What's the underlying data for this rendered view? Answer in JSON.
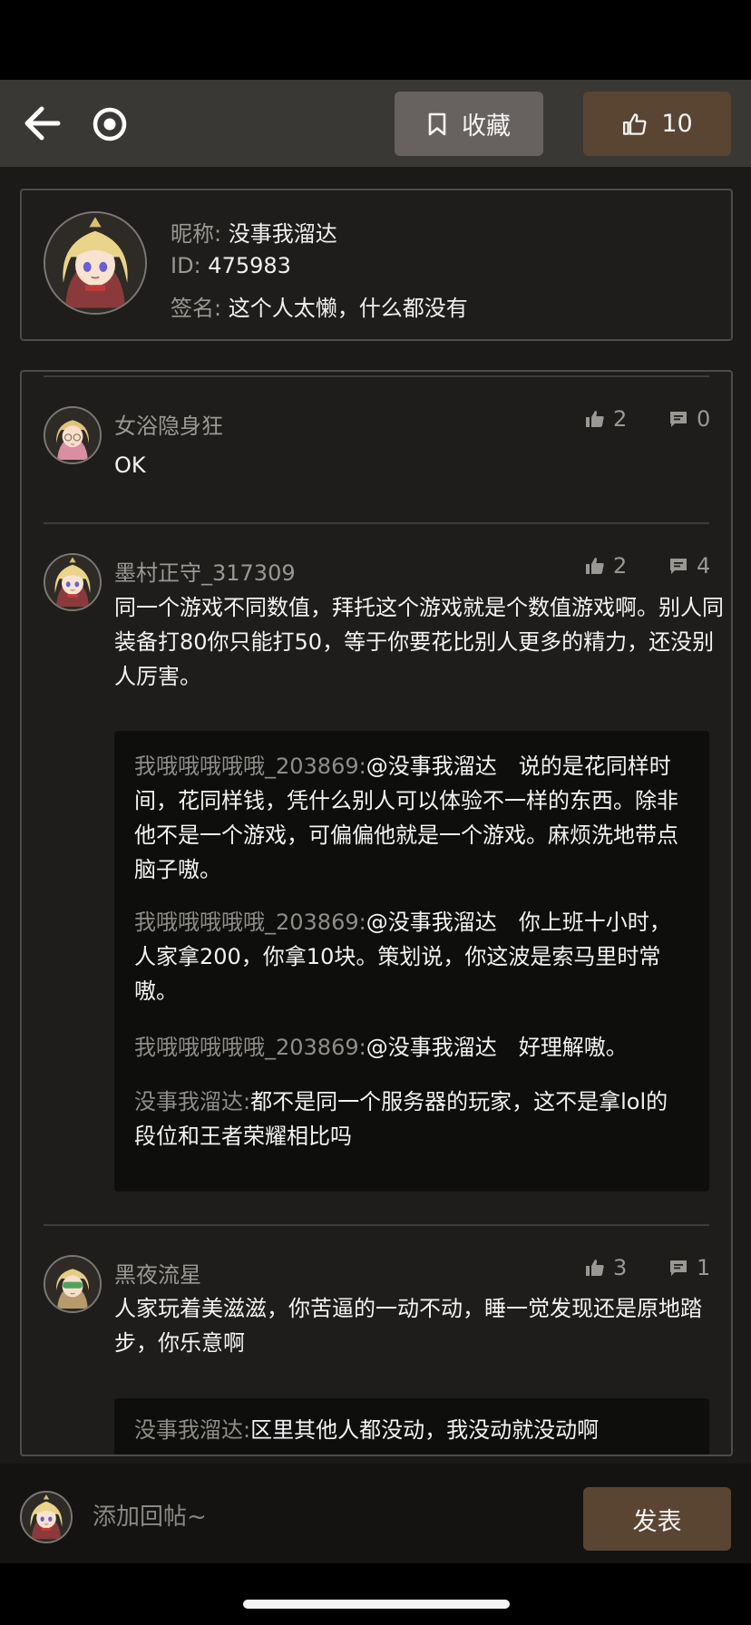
{
  "header": {
    "favorite_label": "收藏",
    "like_count": "10"
  },
  "profile": {
    "nickname_key": "昵称:",
    "nickname": "没事我溜达",
    "id_key": "ID:",
    "id": "475983",
    "signature_key": "签名:",
    "signature": "这个人太懒，什么都没有"
  },
  "comments": [
    {
      "author": "女浴隐身狂",
      "likes": "2",
      "replies_count": "0",
      "text": "OK"
    },
    {
      "author": "墨村正守_317309",
      "likes": "2",
      "replies_count": "4",
      "text": "同一个游戏不同数值，拜托这个游戏就是个数值游戏啊。别人同装备打80你只能打50，等于你要花比别人更多的精力，还没别人厉害。",
      "replies": [
        {
          "name": "我哦哦哦哦哦_203869:",
          "text": "@没事我溜达　说的是花同样时间，花同样钱，凭什么别人可以体验不一样的东西。除非他不是一个游戏，可偏偏他就是一个游戏。麻烦洗地带点脑子嗷。"
        },
        {
          "name": "我哦哦哦哦哦_203869:",
          "text": "@没事我溜达　你上班十小时，人家拿200，你拿10块。策划说，你这波是索马里时常嗷。"
        },
        {
          "name": "我哦哦哦哦哦_203869:",
          "text": "@没事我溜达　好理解嗷。"
        },
        {
          "name": "没事我溜达:",
          "text": "都不是同一个服务器的玩家，这不是拿lol的段位和王者荣耀相比吗"
        }
      ]
    },
    {
      "author": "黑夜流星",
      "likes": "3",
      "replies_count": "1",
      "text": "人家玩着美滋滋，你苦逼的一动不动，睡一觉发现还是原地踏步，你乐意啊",
      "replies": [
        {
          "name": "没事我溜达:",
          "text": "区里其他人都没动，我没动就没动啊"
        }
      ]
    }
  ],
  "composer": {
    "placeholder": "添加回帖~",
    "send_label": "发表"
  },
  "icons": {
    "back": "arrow-left-icon",
    "target": "target-icon",
    "bookmark": "bookmark-icon",
    "thumbs_up": "thumbs-up-icon",
    "comment": "comment-icon"
  },
  "colors": {
    "accent_brown": "#5a4533",
    "favorite_gray": "#67615f",
    "topbar": "#3a3834",
    "background": "#1b1a19"
  }
}
